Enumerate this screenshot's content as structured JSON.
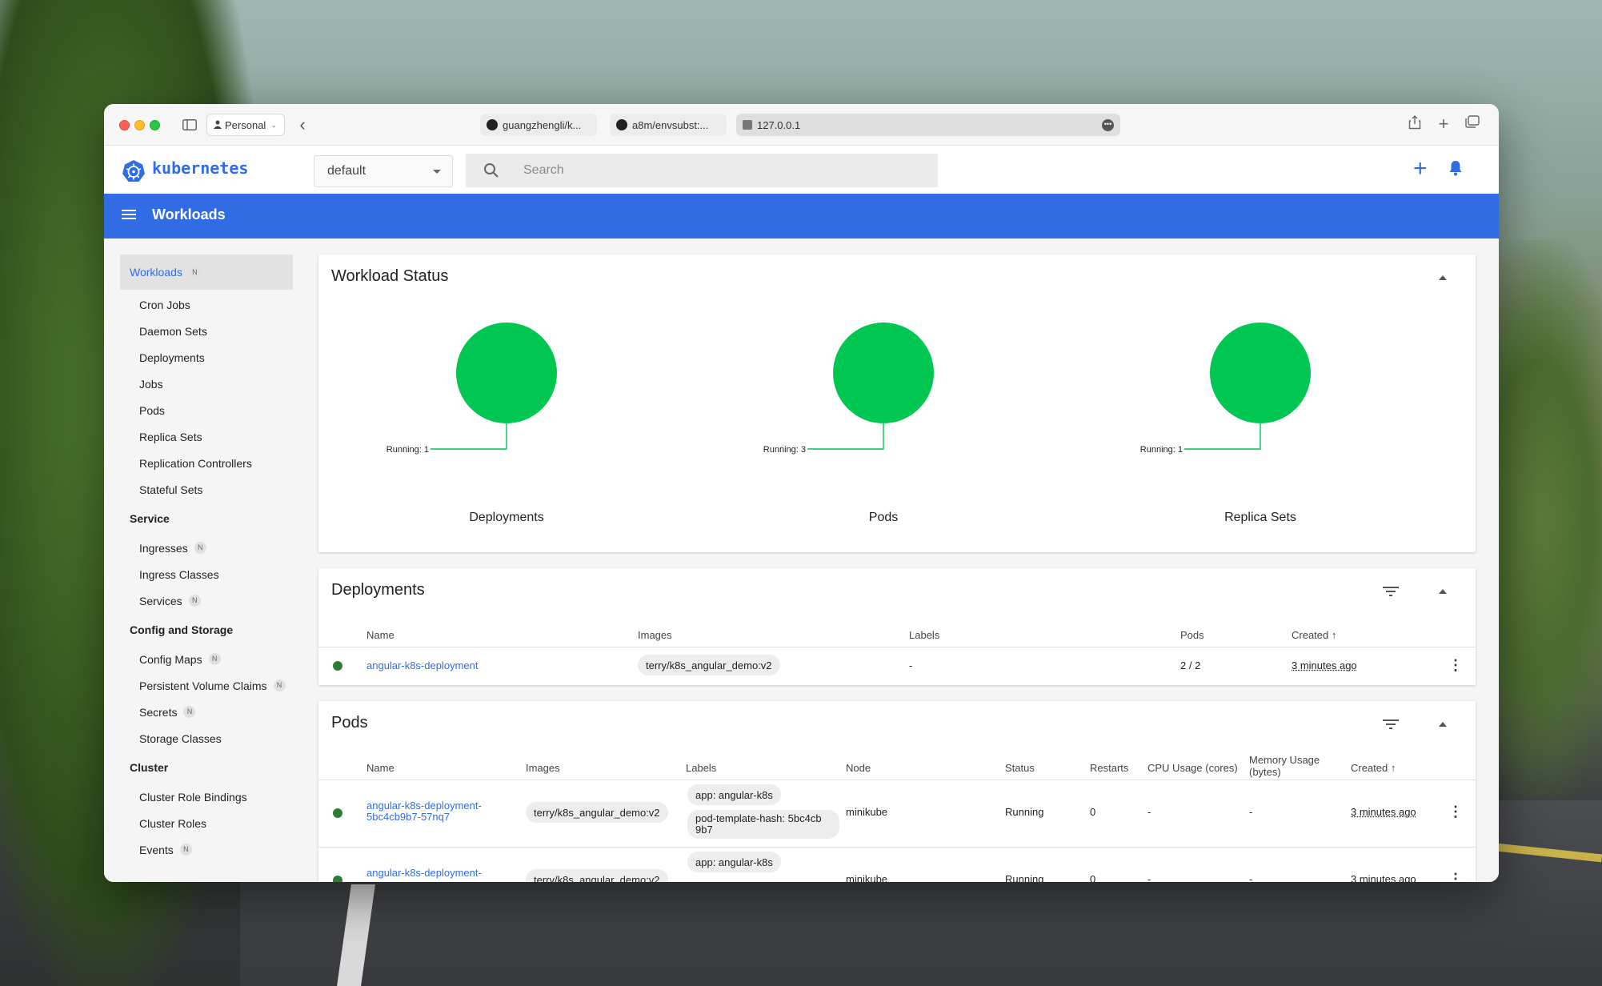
{
  "browser": {
    "profile": "Personal",
    "tabs": [
      {
        "label": "guangzhengli/k..."
      },
      {
        "label": "a8m/envsubst:..."
      },
      {
        "label": "127.0.0.1"
      }
    ]
  },
  "header": {
    "brand": "kubernetes",
    "namespace": "default",
    "search_placeholder": "Search"
  },
  "toolbar": {
    "title": "Workloads"
  },
  "nav": {
    "active": {
      "label": "Workloads",
      "badge": "N"
    },
    "workloads_items": [
      "Cron Jobs",
      "Daemon Sets",
      "Deployments",
      "Jobs",
      "Pods",
      "Replica Sets",
      "Replication Controllers",
      "Stateful Sets"
    ],
    "service_title": "Service",
    "service_items": [
      {
        "label": "Ingresses",
        "badge": "N"
      },
      {
        "label": "Ingress Classes",
        "badge": ""
      },
      {
        "label": "Services",
        "badge": "N"
      }
    ],
    "config_title": "Config and Storage",
    "config_items": [
      {
        "label": "Config Maps",
        "badge": "N"
      },
      {
        "label": "Persistent Volume Claims",
        "badge": "N"
      },
      {
        "label": "Secrets",
        "badge": "N"
      },
      {
        "label": "Storage Classes",
        "badge": ""
      }
    ],
    "cluster_title": "Cluster",
    "cluster_items": [
      {
        "label": "Cluster Role Bindings",
        "badge": ""
      },
      {
        "label": "Cluster Roles",
        "badge": ""
      },
      {
        "label": "Events",
        "badge": "N"
      }
    ]
  },
  "workload_status": {
    "title": "Workload Status",
    "charts": [
      {
        "label": "Deployments",
        "running_label": "Running: 1",
        "running": 1
      },
      {
        "label": "Pods",
        "running_label": "Running: 3",
        "running": 3
      },
      {
        "label": "Replica Sets",
        "running_label": "Running: 1",
        "running": 1
      }
    ],
    "running_color": "#00c752"
  },
  "chart_data": [
    {
      "type": "pie",
      "title": "Deployments",
      "categories": [
        "Running"
      ],
      "values": [
        1
      ]
    },
    {
      "type": "pie",
      "title": "Pods",
      "categories": [
        "Running"
      ],
      "values": [
        3
      ]
    },
    {
      "type": "pie",
      "title": "Replica Sets",
      "categories": [
        "Running"
      ],
      "values": [
        1
      ]
    }
  ],
  "deployments": {
    "title": "Deployments",
    "columns": {
      "name": "Name",
      "images": "Images",
      "labels": "Labels",
      "pods": "Pods",
      "created": "Created"
    },
    "rows": [
      {
        "name": "angular-k8s-deployment",
        "image": "terry/k8s_angular_demo:v2",
        "labels": "-",
        "pods": "2 / 2",
        "created": "3 minutes ago"
      }
    ]
  },
  "pods": {
    "title": "Pods",
    "columns": {
      "name": "Name",
      "images": "Images",
      "labels": "Labels",
      "node": "Node",
      "status": "Status",
      "restarts": "Restarts",
      "cpu": "CPU Usage (cores)",
      "memory_1": "Memory Usage",
      "memory_2": "(bytes)",
      "created": "Created"
    },
    "rows": [
      {
        "name_1": "angular-k8s-deployment-",
        "name_2": "5bc4cb9b7-57nq7",
        "image": "terry/k8s_angular_demo:v2",
        "label_1": "app: angular-k8s",
        "label_2": "pod-template-hash: 5bc4cb 9b7",
        "node": "minikube",
        "status": "Running",
        "restarts": "0",
        "cpu": "-",
        "memory": "-",
        "created": "3 minutes ago"
      },
      {
        "name_1": "angular-k8s-deployment-",
        "name_2": "",
        "image": "terry/k8s_angular_demo:v2",
        "label_1": "app: angular-k8s",
        "label_2": "",
        "node": "minikube",
        "status": "Running",
        "restarts": "0",
        "cpu": "-",
        "memory": "-",
        "created": "3 minutes ago"
      }
    ]
  }
}
